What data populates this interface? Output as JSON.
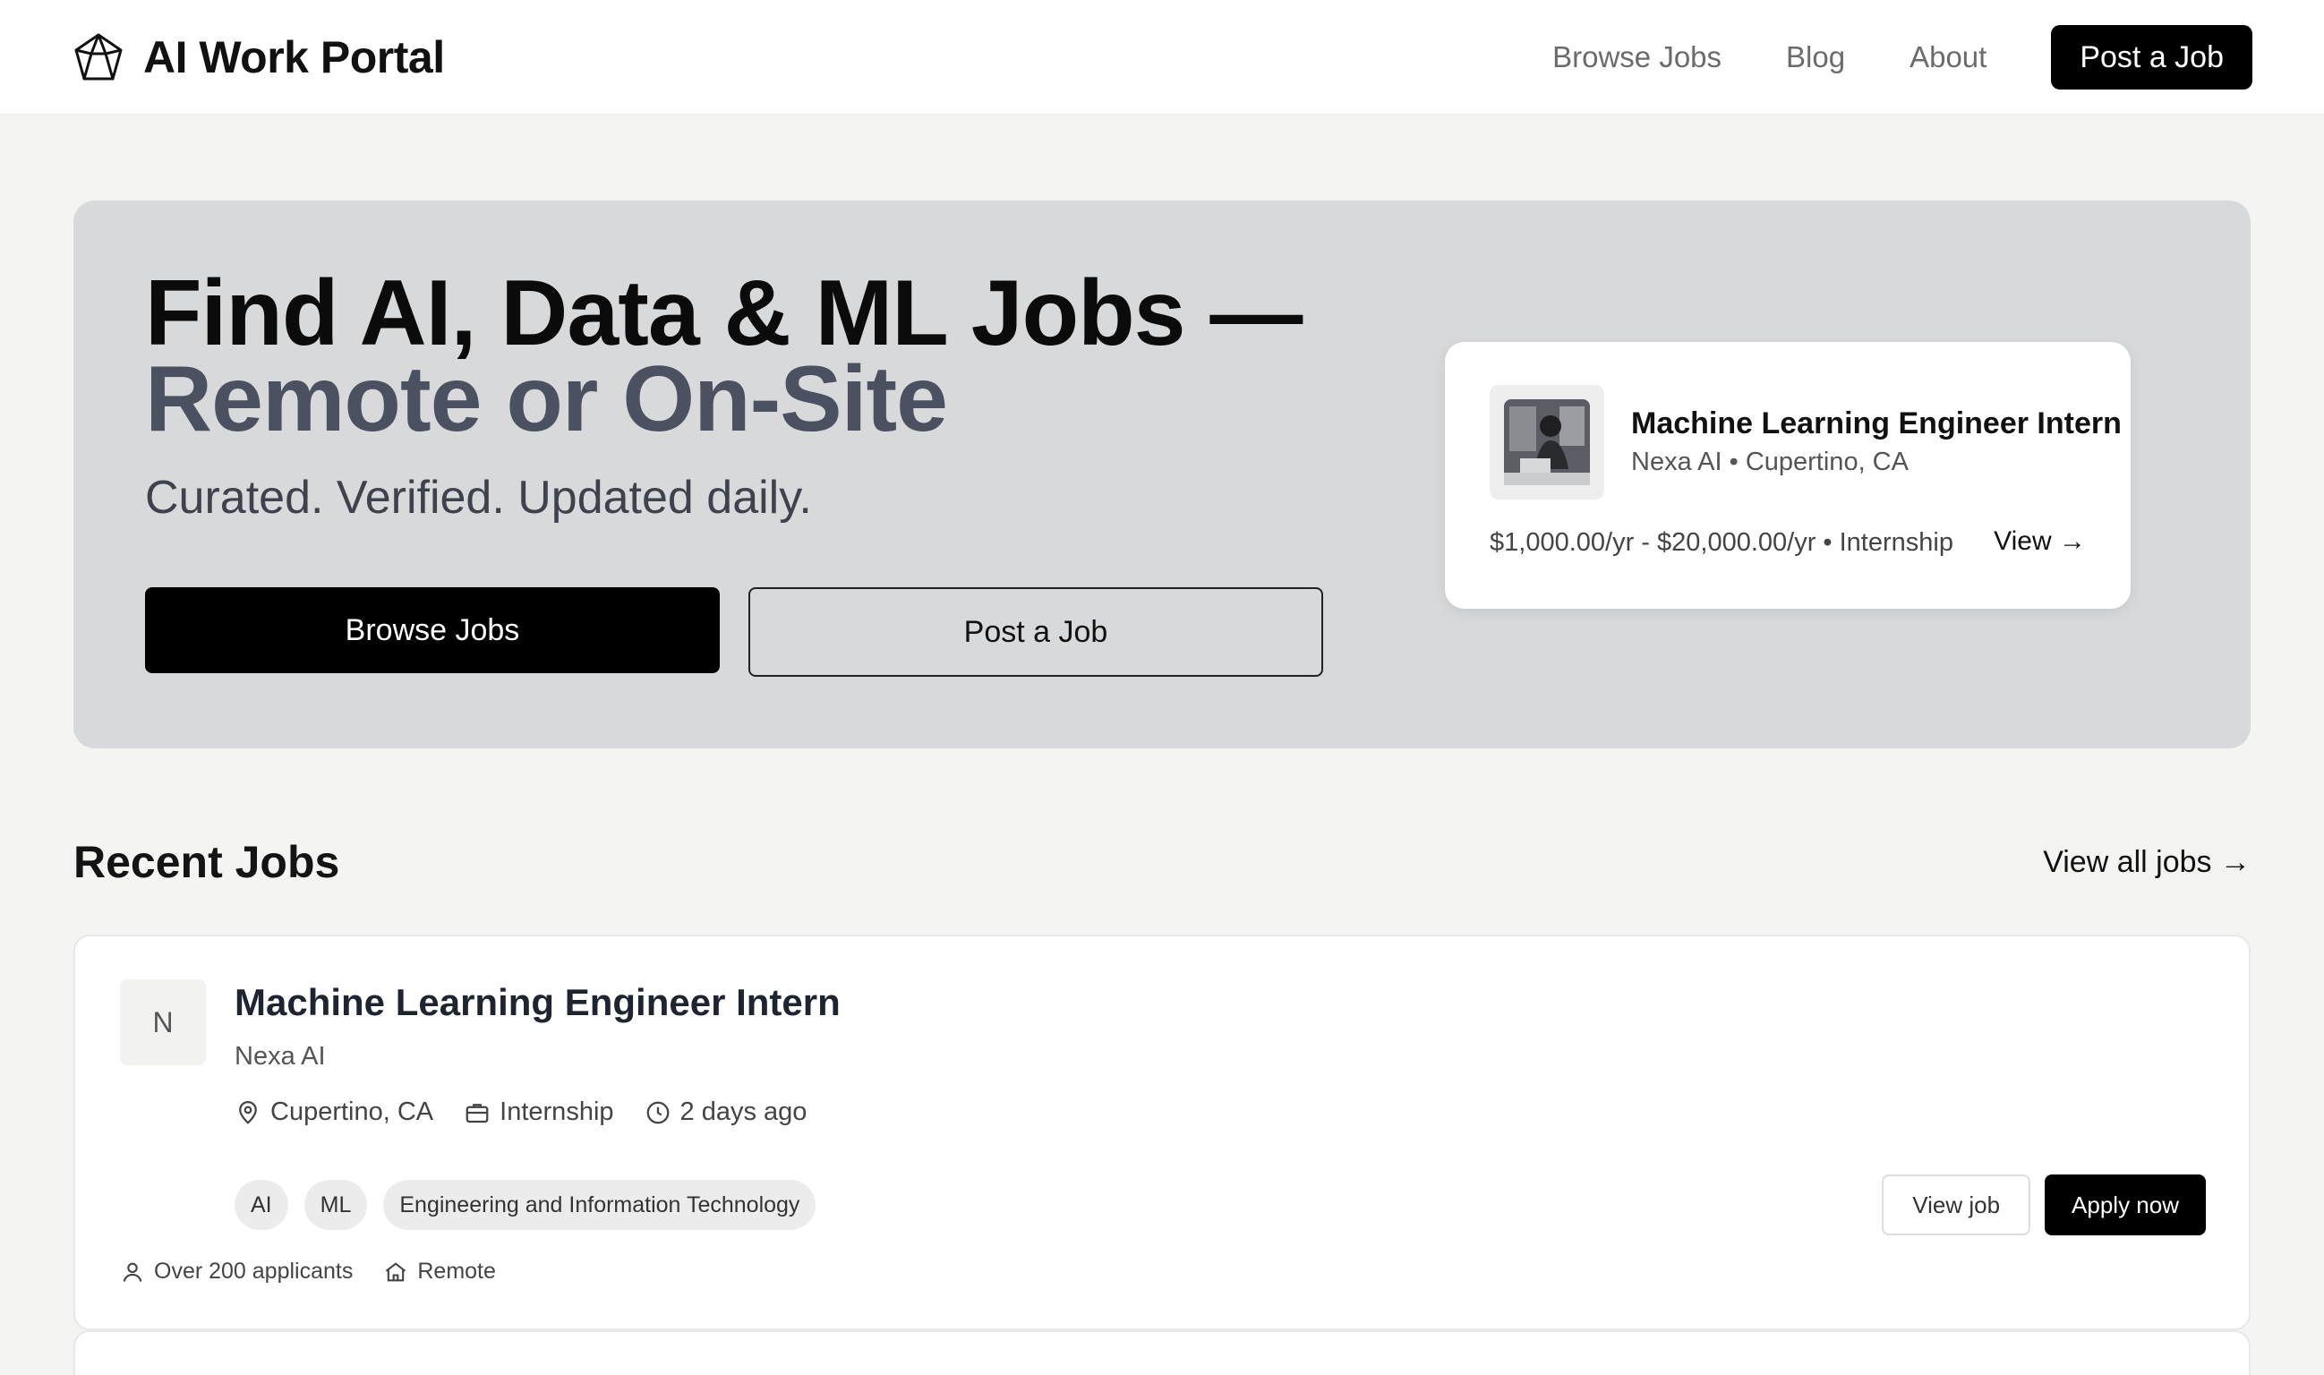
{
  "brand": {
    "name": "AI Work Portal",
    "logo_icon": "pentagon-gem-icon"
  },
  "nav": {
    "links": [
      "Browse Jobs",
      "Blog",
      "About"
    ],
    "cta": "Post a Job"
  },
  "hero": {
    "title_line1": "Find AI, Data & ML Jobs —",
    "title_line2": "Remote or On-Site",
    "subtitle": "Curated. Verified. Updated daily.",
    "primary_button": "Browse Jobs",
    "secondary_button": "Post a Job"
  },
  "featured_job": {
    "title": "Machine Learning Engineer Intern",
    "meta": "Nexa AI • Cupertino, CA",
    "salary_type": "$1,000.00/yr - $20,000.00/yr • Internship",
    "view_label": "View →"
  },
  "recent_jobs": {
    "title": "Recent Jobs",
    "view_all": "View all jobs →",
    "jobs": [
      {
        "logo_letter": "N",
        "title": "Machine Learning Engineer Intern",
        "company": "Nexa AI",
        "location": "Cupertino, CA",
        "type": "Internship",
        "posted": "2 days ago",
        "tags": [
          "AI",
          "ML",
          "Engineering and Information Technology"
        ],
        "applicants": "Over 200 applicants",
        "work_mode": "Remote",
        "view_label": "View job",
        "apply_label": "Apply now"
      }
    ]
  },
  "colors": {
    "page_bg": "#f4f4f2",
    "hero_bg": "#d8d9db",
    "accent_dark": "#000000",
    "title_muted": "#4b5160"
  }
}
